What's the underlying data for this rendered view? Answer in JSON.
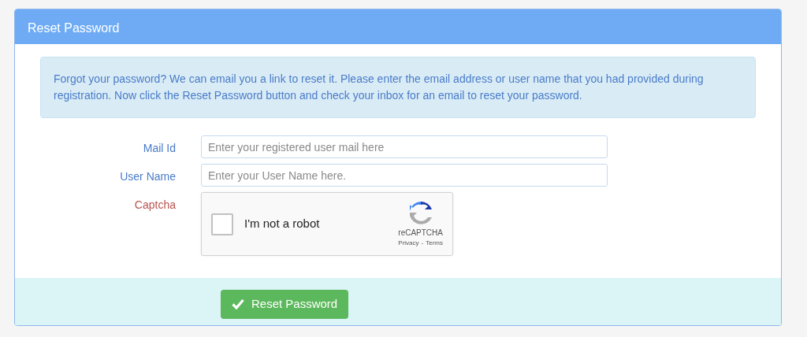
{
  "panel": {
    "title": "Reset Password"
  },
  "info": "Forgot your password? We can email you a link to reset it. Please enter the email address or user name that you had provided during registration. Now click the Reset Password button and check your inbox for an email to reset your password.",
  "fields": [
    {
      "kind": "text",
      "label": "Mail Id",
      "color": "#4a7bc8",
      "placeholder": "Enter your registered user mail here"
    },
    {
      "kind": "text",
      "label": "User Name",
      "color": "#4a7bc8",
      "placeholder": "Enter your User Name here."
    },
    {
      "kind": "captcha",
      "label": "Captcha",
      "color": "#b9534f",
      "checkbox_label": "I'm not a robot",
      "checked": false,
      "brand": "reCAPTCHA",
      "links": [
        "Privacy",
        "Terms"
      ],
      "link_separator": "-"
    }
  ],
  "submit": {
    "label": "Reset Password"
  }
}
